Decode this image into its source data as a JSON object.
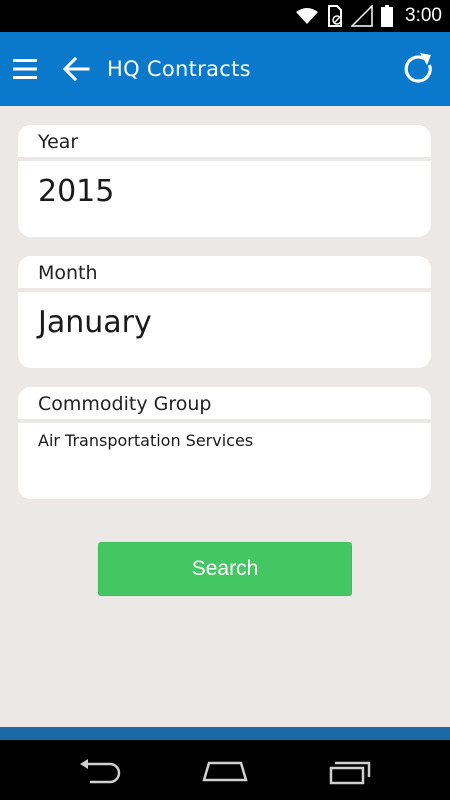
{
  "status_bar": {
    "time": "3:00",
    "icons": [
      "wifi-icon",
      "sim-blocked-icon",
      "signal-icon",
      "battery-icon"
    ]
  },
  "app_bar": {
    "title": "HQ Contracts",
    "color": "#0a79cc",
    "icons": [
      "menu-icon",
      "back-arrow-icon",
      "refresh-icon"
    ]
  },
  "form": {
    "year": {
      "label": "Year",
      "value": "2015"
    },
    "month": {
      "label": "Month",
      "value": "January"
    },
    "commodity_group": {
      "label": "Commodity Group",
      "value": "Air Transportation Services"
    }
  },
  "search_button": {
    "label": "Search",
    "color": "#44c663"
  },
  "nav_bar": {
    "icons": [
      "nav-back-icon",
      "nav-home-icon",
      "nav-recents-icon"
    ]
  }
}
